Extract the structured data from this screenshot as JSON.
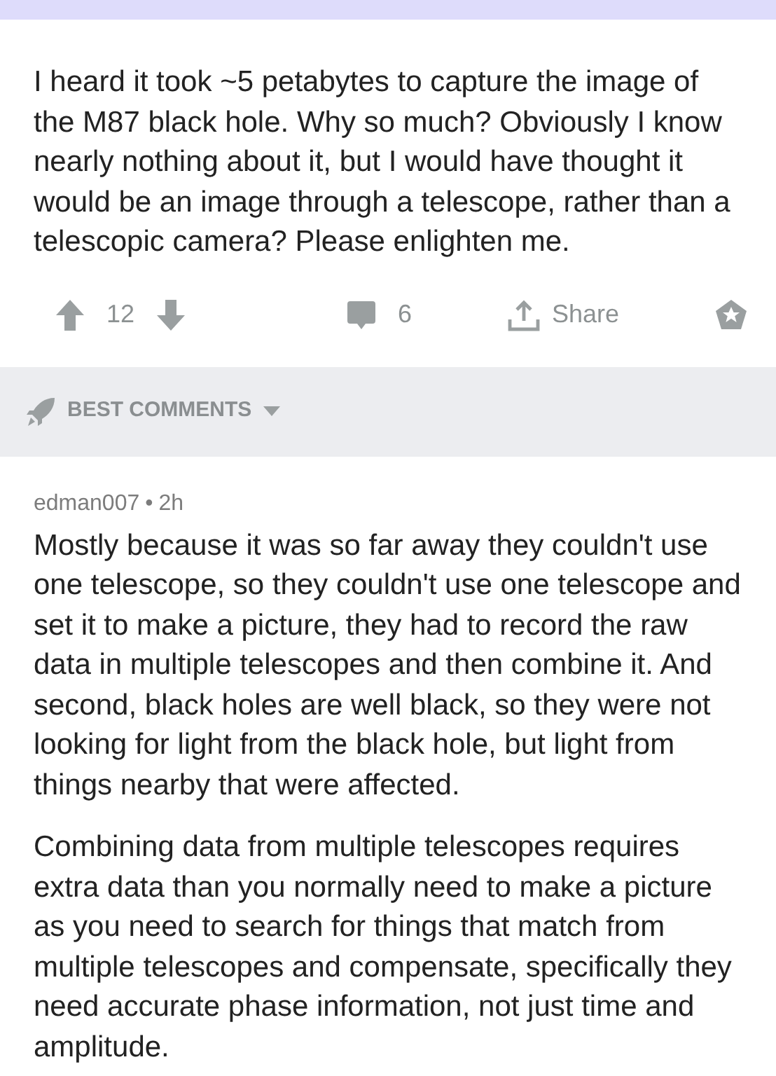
{
  "post": {
    "text": "I heard it took ~5 petabytes to capture the image of the M87 black hole. Why so much? Obviously I know nearly nothing about it, but I would have thought it would be an image through a telescope, rather than a telescopic camera? Please enlighten me.",
    "score": "12",
    "comment_count": "6",
    "share_label": "Share"
  },
  "sort": {
    "label": "BEST COMMENTS"
  },
  "comments": [
    {
      "author": "edman007",
      "separator": "•",
      "time": "2h",
      "paragraphs": [
        "Mostly because it was so far away they couldn't use one telescope, so they couldn't use one telescope and set it to make a picture, they had to record the raw data in multiple telescopes and then combine it. And second, black holes are well black, so they were not looking for light from the black hole, but light from things nearby that were affected.",
        "Combining data from multiple telescopes requires extra data than you normally need to make a picture as you need to search for things that match from multiple telescopes and compensate, specifically they need accurate phase information, not just time and amplitude."
      ]
    }
  ]
}
